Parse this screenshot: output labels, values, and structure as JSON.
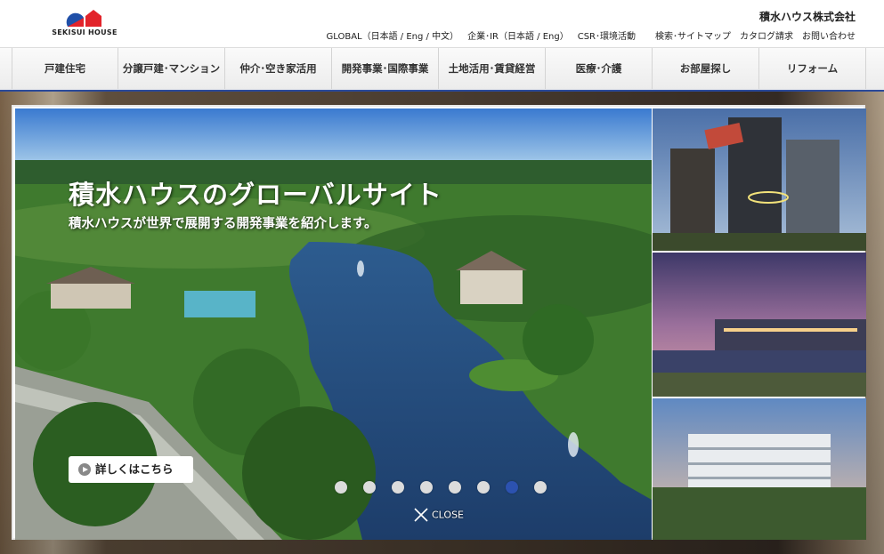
{
  "header": {
    "logo_text": "SEKISUI HOUSE",
    "company_name": "積水ハウス株式会社",
    "links": {
      "global": "GLOBAL（日本語 / Eng / 中文）",
      "corporate_ir": "企業･IR（日本語 / Eng）",
      "csr": "CSR･環境活動",
      "search_sitemap": "検索･サイトマップ",
      "catalog": "カタログ請求",
      "contact": "お問い合わせ"
    }
  },
  "nav": {
    "items": [
      {
        "label": "戸建住宅"
      },
      {
        "label": "分譲戸建･マンション"
      },
      {
        "label": "仲介･空き家活用"
      },
      {
        "label": "開発事業･国際事業"
      },
      {
        "label": "土地活用･賃貸経営"
      },
      {
        "label": "医療･介護"
      },
      {
        "label": "お部屋探し"
      },
      {
        "label": "リフォーム"
      }
    ]
  },
  "hero": {
    "title": "積水ハウスのグローバルサイト",
    "subtitle": "積水ハウスが世界で展開する開発事業を紹介します。",
    "detail_button": "詳しくはこちら",
    "close_label": "CLOSE",
    "slide_count": 8,
    "active_slide": 7
  },
  "colors": {
    "accent": "#2b4a9a",
    "active_dot": "#2c52b0",
    "logo_blue": "#1f4fa8",
    "logo_red": "#e2232a"
  }
}
